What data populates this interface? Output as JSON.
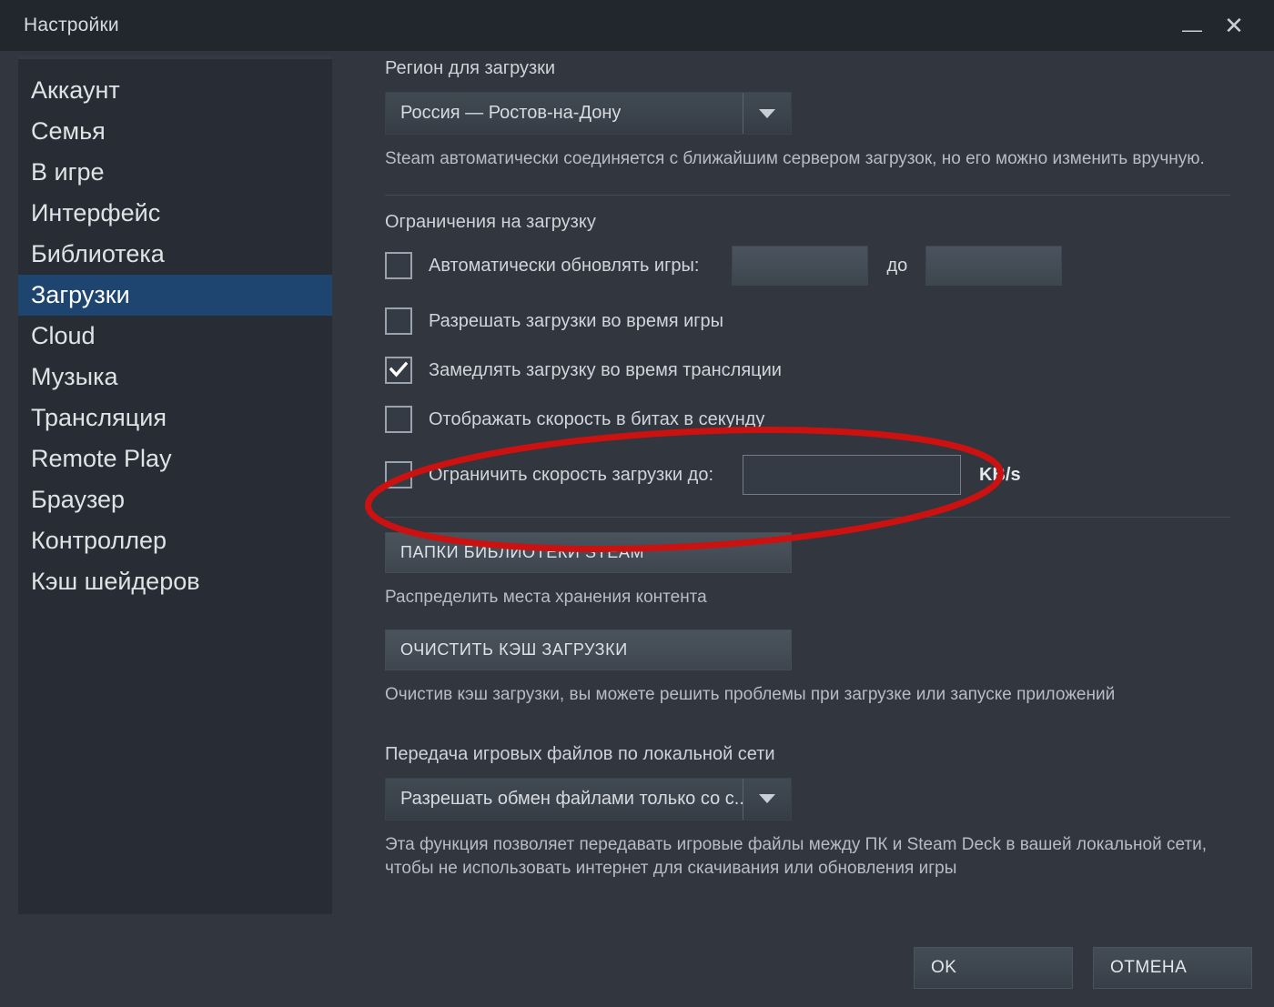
{
  "window": {
    "title": "Настройки",
    "minimize_icon": "minimize-icon",
    "close_icon": "close-icon"
  },
  "sidebar": {
    "items": [
      {
        "label": "Аккаунт",
        "selected": false
      },
      {
        "label": "Семья",
        "selected": false
      },
      {
        "label": "В игре",
        "selected": false
      },
      {
        "label": "Интерфейс",
        "selected": false
      },
      {
        "label": "Библиотека",
        "selected": false
      },
      {
        "label": "Загрузки",
        "selected": true
      },
      {
        "label": "Cloud",
        "selected": false
      },
      {
        "label": "Музыка",
        "selected": false
      },
      {
        "label": "Трансляция",
        "selected": false
      },
      {
        "label": "Remote Play",
        "selected": false
      },
      {
        "label": "Браузер",
        "selected": false
      },
      {
        "label": "Контроллер",
        "selected": false
      },
      {
        "label": "Кэш шейдеров",
        "selected": false
      }
    ]
  },
  "main": {
    "region": {
      "heading": "Регион для загрузки",
      "selected": "Россия — Ростов-на-Дону",
      "hint": "Steam автоматически соединяется с ближайшим сервером загрузок, но его можно изменить вручную."
    },
    "restrictions": {
      "heading": "Ограничения на загрузку",
      "auto_update": {
        "label": "Автоматически обновлять игры:",
        "checked": false,
        "from_value": "",
        "between_label": "до",
        "to_value": ""
      },
      "allow_during_play": {
        "label": "Разрешать загрузки во время игры",
        "checked": false
      },
      "throttle_while_streaming": {
        "label": "Замедлять загрузку во время трансляции",
        "checked": true
      },
      "show_bits": {
        "label": "Отображать скорость в битах в секунду",
        "checked": false
      },
      "limit_speed": {
        "label": "Ограничить скорость загрузки до:",
        "checked": false,
        "value": "",
        "unit": "KB/s"
      }
    },
    "storage": {
      "library_folders_button": "ПАПКИ БИБЛИОТЕКИ STEAM",
      "library_folders_hint": "Распределить места хранения контента",
      "clear_cache_button": "ОЧИСТИТЬ КЭШ ЗАГРУЗКИ",
      "clear_cache_hint": "Очистив кэш загрузки, вы можете решить проблемы при загрузке или запуске приложений"
    },
    "lan": {
      "heading": "Передача игровых файлов по локальной сети",
      "selected": "Разрешать обмен файлами только со с..",
      "hint": "Эта функция позволяет передавать игровые файлы между ПК и Steam Deck в вашей локальной сети, чтобы не использовать интернет для скачивания или обновления игры"
    }
  },
  "footer": {
    "ok_label": "OK",
    "cancel_label": "ОТМЕНА"
  },
  "annotation": {
    "shape": "ellipse-highlight",
    "color": "#cc1111"
  }
}
